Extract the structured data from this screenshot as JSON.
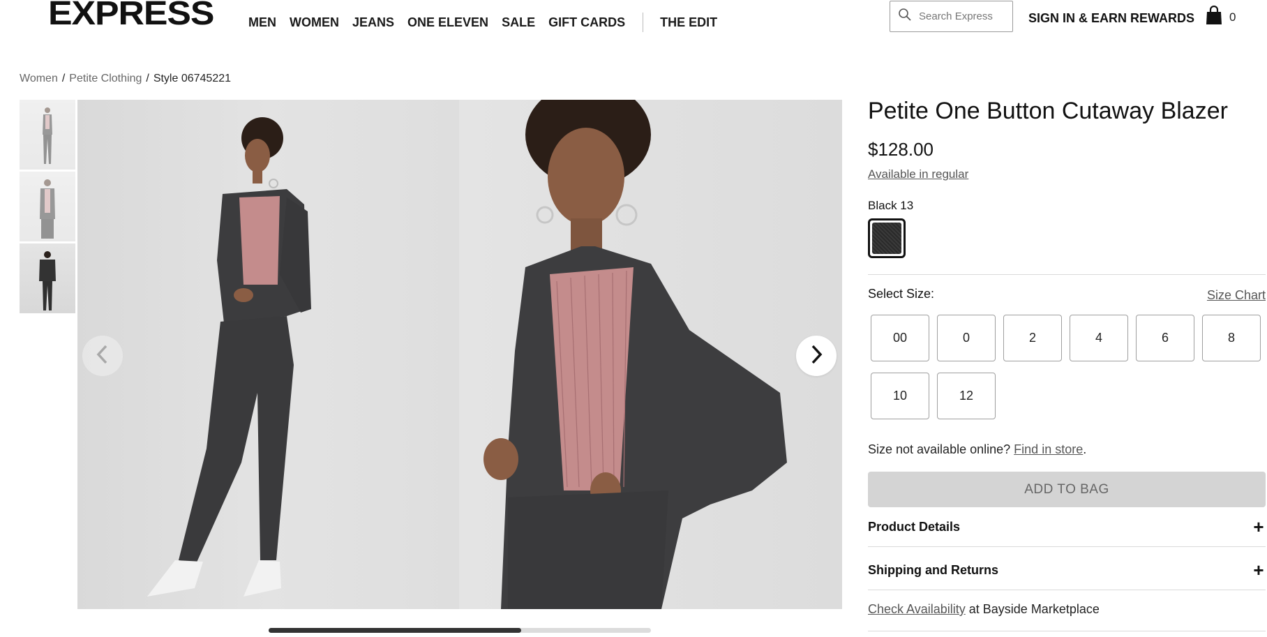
{
  "header": {
    "logo": "EXPRESS",
    "nav": [
      "MEN",
      "WOMEN",
      "JEANS",
      "ONE ELEVEN",
      "SALE",
      "GIFT CARDS"
    ],
    "nav_extra": "THE EDIT",
    "search_placeholder": "Search Express",
    "sign_in": "SIGN IN & EARN REWARDS",
    "bag_count": "0"
  },
  "breadcrumb": {
    "items": [
      "Women",
      "Petite Clothing"
    ],
    "current": "Style 06745221",
    "separator": "/"
  },
  "gallery": {
    "thumbnail_count": 3,
    "active_thumbnail": 3,
    "scroll_progress": 0.66
  },
  "product": {
    "title": "Petite One Button Cutaway Blazer",
    "price": "$128.00",
    "regular_link": "Available in regular",
    "color_label": "Black 13",
    "swatch_color": "#333333",
    "select_size_label": "Select Size:",
    "size_chart_link": "Size Chart",
    "sizes": [
      "00",
      "0",
      "2",
      "4",
      "6",
      "8",
      "10",
      "12"
    ],
    "not_available_text": "Size not available online?",
    "find_in_store": "Find in store",
    "period": ".",
    "add_to_bag": "ADD TO BAG",
    "product_details": "Product Details",
    "shipping_returns": "Shipping and Returns",
    "plus": "+",
    "check_availability": "Check Availability",
    "store_text": "at Bayside Marketplace"
  }
}
